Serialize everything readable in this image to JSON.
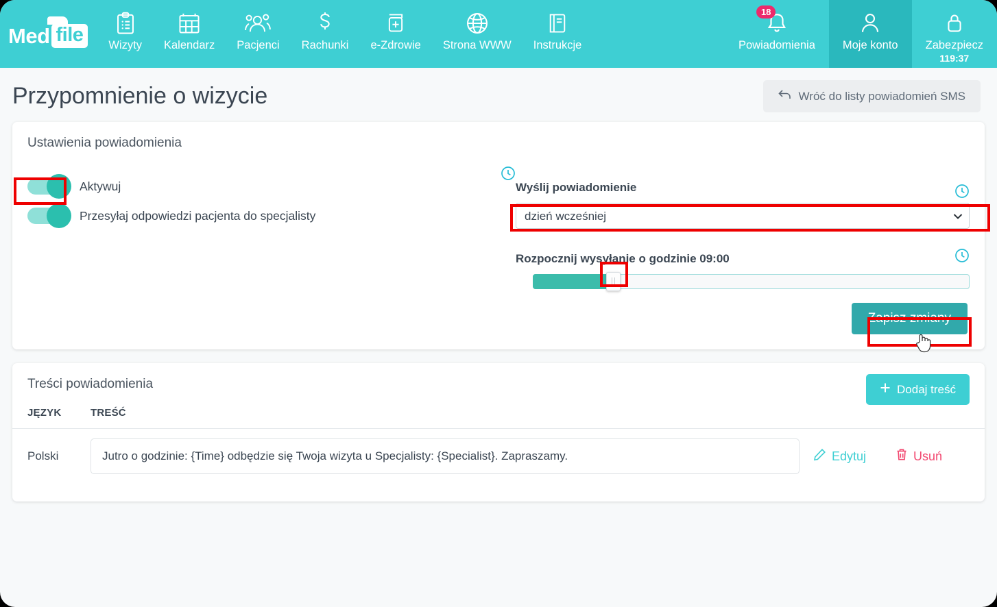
{
  "header": {
    "brand": {
      "part1": "Med",
      "part2": "file"
    },
    "nav": [
      {
        "label": "Wizyty",
        "icon": "clipboard-icon"
      },
      {
        "label": "Kalendarz",
        "icon": "calendar-icon"
      },
      {
        "label": "Pacjenci",
        "icon": "people-icon"
      },
      {
        "label": "Rachunki",
        "icon": "dollar-icon"
      },
      {
        "label": "e-Zdrowie",
        "icon": "medical-file-icon"
      },
      {
        "label": "Strona WWW",
        "icon": "globe-icon"
      },
      {
        "label": "Instrukcje",
        "icon": "book-icon"
      }
    ],
    "right": [
      {
        "label": "Powiadomienia",
        "icon": "bell-icon",
        "badge": "18"
      },
      {
        "label": "Moje konto",
        "icon": "user-icon",
        "active": true
      },
      {
        "label": "Zabezpiecz",
        "icon": "lock-icon",
        "timer": "119:37"
      }
    ],
    "bg_color": "#3ecfd3",
    "active_color": "#2ab8bd",
    "badge_color": "#ec2a6c"
  },
  "page": {
    "title": "Przypomnienie o wizycie",
    "back_button": "Wróć do listy powiadomień SMS"
  },
  "settings": {
    "card_title": "Ustawienia powiadomienia",
    "toggle_activate": {
      "label": "Aktywuj",
      "on": true
    },
    "toggle_forward": {
      "label": "Przesyłaj odpowiedzi pacjenta do specjalisty",
      "on": true
    },
    "send_label": "Wyślij powiadomienie",
    "send_value": "dzień wcześniej",
    "send_options": [
      "dzień wcześniej"
    ],
    "slider_label": "Rozpocznij wysyłanie o godzinie 09:00",
    "slider_time": "09:00",
    "save_button": "Zapisz zmiany",
    "accent_color": "#3ecfd3",
    "save_color": "#31a9ab"
  },
  "contents": {
    "card_title": "Treści powiadomienia",
    "add_button": "Dodaj treść",
    "columns": [
      "JĘZYK",
      "TREŚĆ"
    ],
    "rows": [
      {
        "language": "Polski",
        "message": "Jutro o godzinie: {Time} odbędzie się Twoja wizyta u Specjalisty: {Specialist}. Zapraszamy.",
        "edit": "Edytuj",
        "delete": "Usuń"
      }
    ],
    "edit_color": "#3ecfd3",
    "delete_color": "#f2476f"
  },
  "annotations": {
    "color": "#ee0000",
    "targets": [
      "toggle-activate",
      "send-select",
      "slider-handle",
      "save-button"
    ]
  }
}
